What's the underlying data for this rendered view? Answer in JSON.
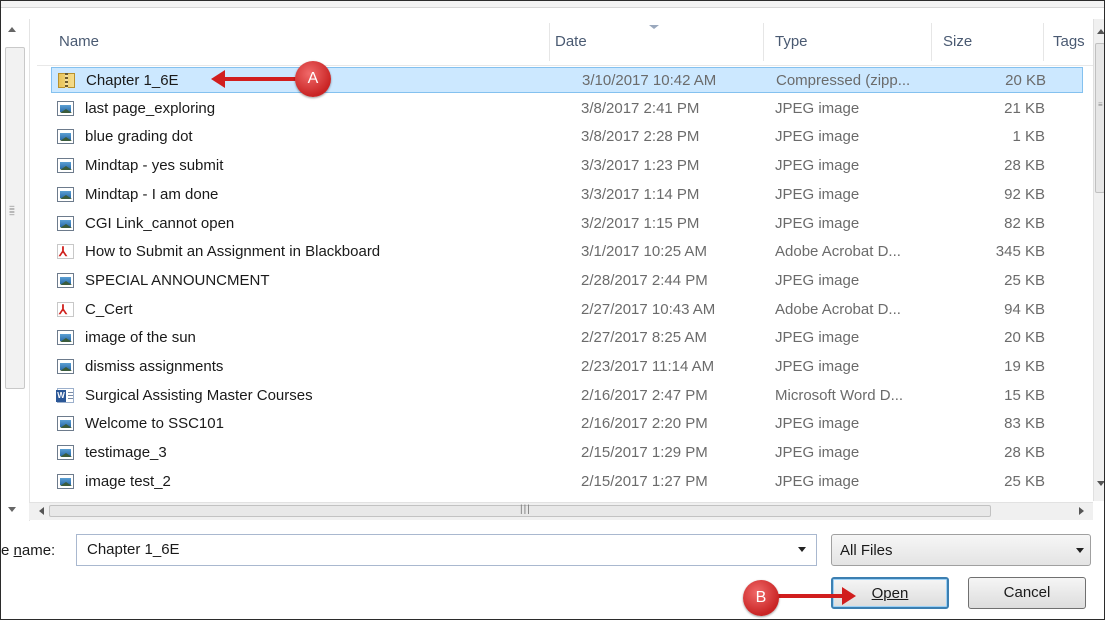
{
  "columns": {
    "name": "Name",
    "date": "Date",
    "type": "Type",
    "size": "Size",
    "tags": "Tags"
  },
  "files": [
    {
      "name": "Chapter 1_6E",
      "date": "3/10/2017 10:42 AM",
      "type": "Compressed (zipp...",
      "size": "20 KB",
      "icon": "zip-folder-icon",
      "selected": true
    },
    {
      "name": "last page_exploring",
      "date": "3/8/2017 2:41 PM",
      "type": "JPEG image",
      "size": "21 KB",
      "icon": "image-file-icon"
    },
    {
      "name": "blue grading dot",
      "date": "3/8/2017 2:28 PM",
      "type": "JPEG image",
      "size": "1 KB",
      "icon": "image-file-icon"
    },
    {
      "name": "Mindtap - yes submit",
      "date": "3/3/2017 1:23 PM",
      "type": "JPEG image",
      "size": "28 KB",
      "icon": "image-file-icon"
    },
    {
      "name": "Mindtap - I am done",
      "date": "3/3/2017 1:14 PM",
      "type": "JPEG image",
      "size": "92 KB",
      "icon": "image-file-icon"
    },
    {
      "name": "CGI Link_cannot open",
      "date": "3/2/2017 1:15 PM",
      "type": "JPEG image",
      "size": "82 KB",
      "icon": "image-file-icon"
    },
    {
      "name": "How to Submit an Assignment in Blackboard",
      "date": "3/1/2017 10:25 AM",
      "type": "Adobe Acrobat D...",
      "size": "345 KB",
      "icon": "pdf-file-icon"
    },
    {
      "name": "SPECIAL ANNOUNCMENT",
      "date": "2/28/2017 2:44 PM",
      "type": "JPEG image",
      "size": "25 KB",
      "icon": "image-file-icon"
    },
    {
      "name": "C_Cert",
      "date": "2/27/2017 10:43 AM",
      "type": "Adobe Acrobat D...",
      "size": "94 KB",
      "icon": "pdf-file-icon"
    },
    {
      "name": "image of the sun",
      "date": "2/27/2017 8:25 AM",
      "type": "JPEG image",
      "size": "20 KB",
      "icon": "image-file-icon"
    },
    {
      "name": "dismiss assignments",
      "date": "2/23/2017 11:14 AM",
      "type": "JPEG image",
      "size": "19 KB",
      "icon": "image-file-icon"
    },
    {
      "name": "Surgical Assisting Master Courses",
      "date": "2/16/2017 2:47 PM",
      "type": "Microsoft Word D...",
      "size": "15 KB",
      "icon": "word-file-icon"
    },
    {
      "name": "Welcome to SSC101",
      "date": "2/16/2017 2:20 PM",
      "type": "JPEG image",
      "size": "83 KB",
      "icon": "image-file-icon"
    },
    {
      "name": "testimage_3",
      "date": "2/15/2017 1:29 PM",
      "type": "JPEG image",
      "size": "28 KB",
      "icon": "image-file-icon"
    },
    {
      "name": "image test_2",
      "date": "2/15/2017 1:27 PM",
      "type": "JPEG image",
      "size": "25 KB",
      "icon": "image-file-icon"
    }
  ],
  "filename": {
    "label_prefix": "e ",
    "label_underlined": "n",
    "label_suffix": "ame:",
    "value": "Chapter 1_6E"
  },
  "filter": {
    "selected": "All Files"
  },
  "buttons": {
    "open": "Open",
    "cancel": "Cancel"
  },
  "annotations": {
    "a": "A",
    "b": "B",
    "color": "#d11e1e"
  },
  "colors": {
    "selection_bg": "#cce8ff",
    "selection_border": "#84c1ef",
    "header_text": "#4a5a72"
  }
}
